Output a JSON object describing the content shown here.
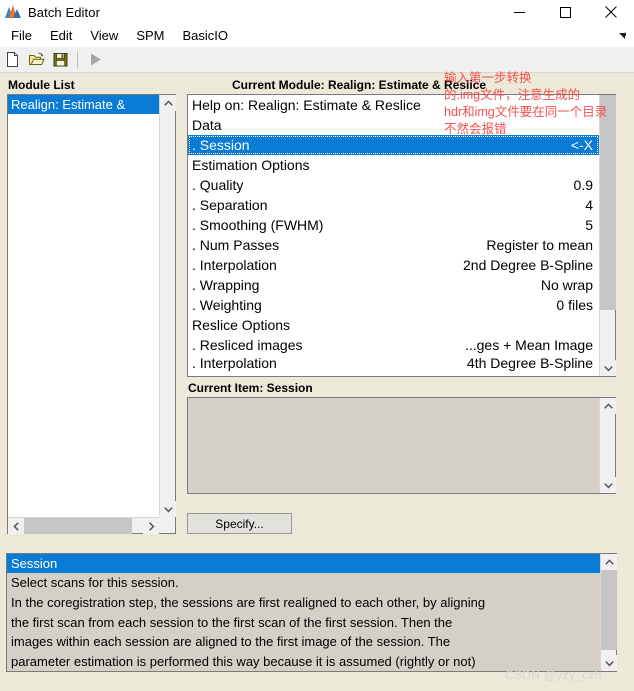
{
  "window": {
    "title": "Batch Editor",
    "icon": "matlab-icon",
    "minimize_label": "minimize-icon",
    "maximize_label": "maximize-icon",
    "close_label": "close-icon"
  },
  "menubar": {
    "items": [
      {
        "label": "File"
      },
      {
        "label": "Edit"
      },
      {
        "label": "View"
      },
      {
        "label": "SPM"
      },
      {
        "label": "BasicIO"
      }
    ],
    "undock_icon": "undock-arrow-icon"
  },
  "toolbar": {
    "buttons": [
      {
        "name": "new-batch-icon",
        "title": "New"
      },
      {
        "name": "open-batch-icon",
        "title": "Open"
      },
      {
        "name": "save-batch-icon",
        "title": "Save"
      },
      {
        "name": "run-batch-icon",
        "title": "Run"
      }
    ]
  },
  "module_list": {
    "label": "Module List",
    "items": [
      {
        "label": "Realign: Estimate &",
        "selected": true
      }
    ]
  },
  "current_module": {
    "label": "Current Module: Realign: Estimate & Reslice",
    "rows": [
      {
        "label": "Help on: Realign: Estimate & Reslice",
        "value": "",
        "kind": "header"
      },
      {
        "label": "Data",
        "value": "",
        "kind": "header"
      },
      {
        "label": ". Session",
        "value": "<-X",
        "kind": "item",
        "selected": true
      },
      {
        "label": "Estimation Options",
        "value": "",
        "kind": "header"
      },
      {
        "label": ". Quality",
        "value": "0.9",
        "kind": "item"
      },
      {
        "label": ". Separation",
        "value": "4",
        "kind": "item"
      },
      {
        "label": ". Smoothing (FWHM)",
        "value": "5",
        "kind": "item"
      },
      {
        "label": ". Num Passes",
        "value": "Register to mean",
        "kind": "item"
      },
      {
        "label": ". Interpolation",
        "value": "2nd Degree B-Spline",
        "kind": "item"
      },
      {
        "label": ". Wrapping",
        "value": "No wrap",
        "kind": "item"
      },
      {
        "label": ". Weighting",
        "value": "0 files",
        "kind": "item"
      },
      {
        "label": "Reslice Options",
        "value": "",
        "kind": "header"
      },
      {
        "label": ". Resliced images",
        "value": "...ges + Mean Image",
        "kind": "item"
      },
      {
        "label": ". Interpolation",
        "value": "4th Degree B-Spline",
        "kind": "item"
      }
    ]
  },
  "annotation": {
    "text": "输入第一步转换\n的.img文件，注意生成的\nhdr和img文件要在同一个目录\n不然会报错",
    "color": "#f4504f"
  },
  "current_item": {
    "label": "Current Item: Session",
    "value": ""
  },
  "specify_button": {
    "label": "Specify..."
  },
  "help_panel": {
    "title": "Session",
    "lines": [
      "Select scans for this session.",
      "In the  coregistration  step, the sessions are first realigned to each other, by aligning",
      "the  first  scan  from  each  session  to  the  first  scan  of  the  first session.  Then the",
      "images  within  each  session  are  aligned  to  the  first  image  of  the  session. The",
      "parameter  estimation  is  performed  this  way because it is assumed (rightly or not)"
    ]
  },
  "watermark": {
    "text": "CSDN @yzy_czh"
  },
  "colors": {
    "accent_blue": "#0a7cd6",
    "panel_bg": "#ece9d8",
    "field_bg": "#d4d0c8",
    "annotation_red": "#f4504f"
  }
}
